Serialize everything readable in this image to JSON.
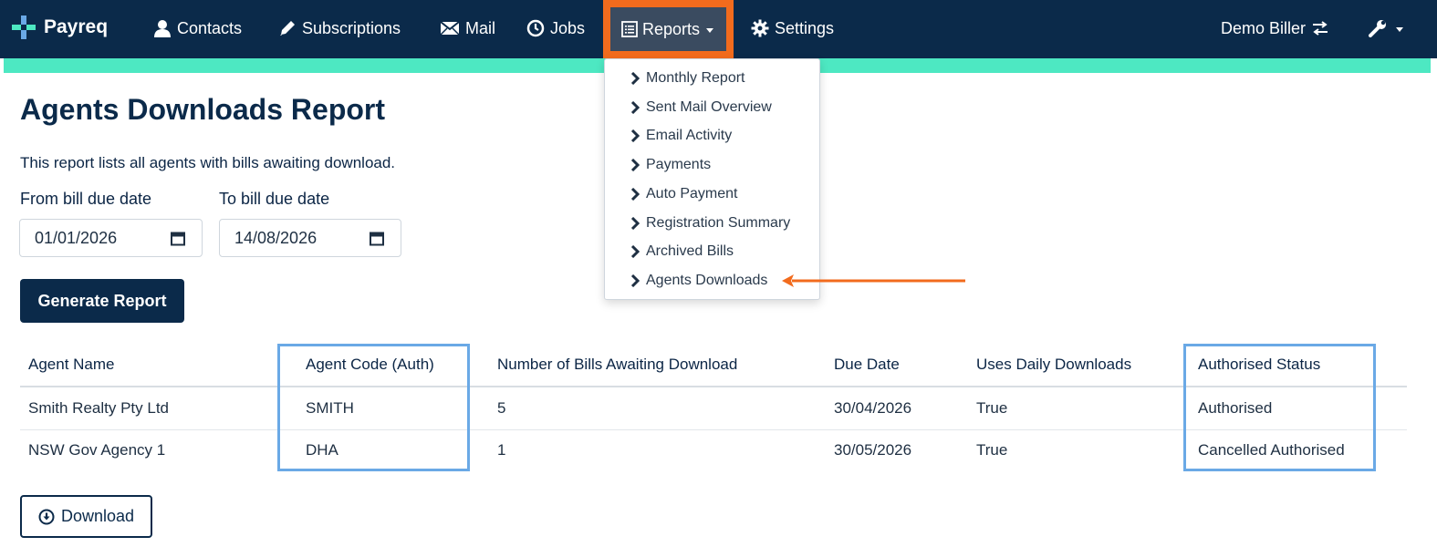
{
  "nav": {
    "brand": "Payreq",
    "contacts": "Contacts",
    "subscriptions": "Subscriptions",
    "mail": "Mail",
    "jobs": "Jobs",
    "reports": "Reports",
    "settings": "Settings",
    "biller": "Demo Biller"
  },
  "reports_menu": [
    "Monthly Report",
    "Sent Mail Overview",
    "Email Activity",
    "Payments",
    "Auto Payment",
    "Registration Summary",
    "Archived Bills",
    "Agents Downloads"
  ],
  "page": {
    "title": "Agents Downloads Report",
    "description": "This report lists all agents with bills awaiting download.",
    "from_label": "From bill due date",
    "from_value": "01/01/2026",
    "to_label": "To bill due date",
    "to_value": "14/08/2026",
    "generate_label": "Generate Report",
    "download_label": "Download"
  },
  "table": {
    "headers": [
      "Agent Name",
      "Agent Code (Auth)",
      "Number of Bills Awaiting Download",
      "Due Date",
      "Uses Daily Downloads",
      "Authorised Status"
    ],
    "rows": [
      [
        "Smith Realty Pty Ltd",
        "SMITH",
        "5",
        "30/04/2026",
        "True",
        "Authorised"
      ],
      [
        "NSW Gov Agency 1",
        "DHA",
        "1",
        "30/05/2026",
        "True",
        "Cancelled Authorised"
      ]
    ]
  },
  "colors": {
    "navbar": "#0b2a4a",
    "accent_strip": "#4de8c2",
    "highlight_orange": "#f26b1d",
    "highlight_blue": "#6aa9e6"
  }
}
